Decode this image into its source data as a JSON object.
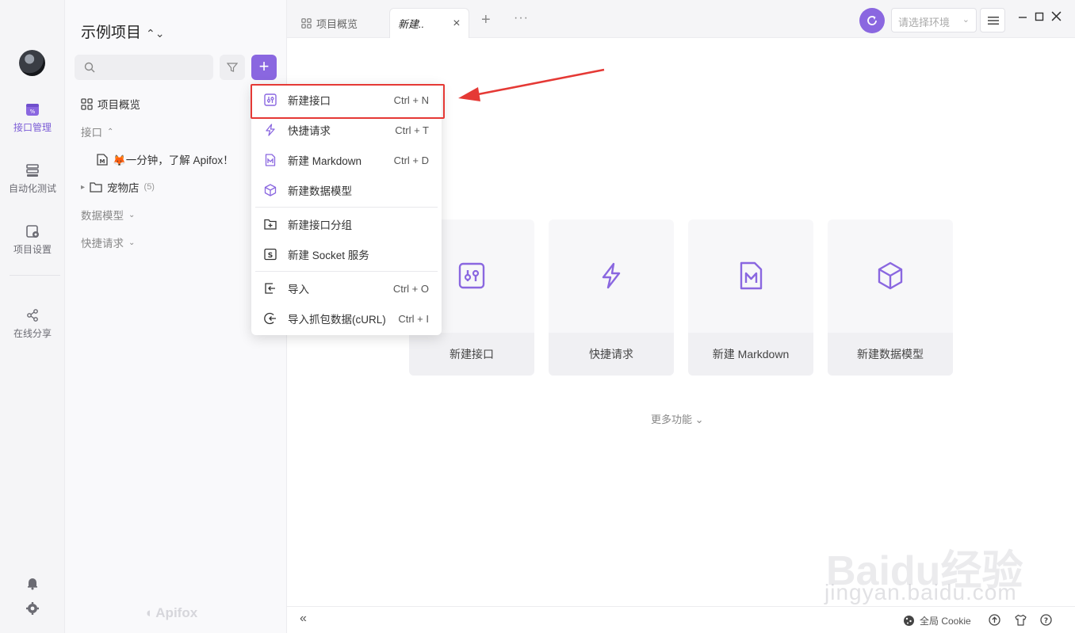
{
  "rail": {
    "items": [
      {
        "label": "接口管理"
      },
      {
        "label": "自动化测试"
      },
      {
        "label": "项目设置"
      },
      {
        "label": "在线分享"
      }
    ]
  },
  "sidebar": {
    "project_title": "示例项目",
    "overview": "项目概览",
    "section_api": "接口",
    "doc_item": "🦊一分钟，了解 Apifox！",
    "folder": "宠物店",
    "folder_count": "(5)",
    "section_models": "数据模型",
    "section_quick": "快捷请求",
    "brand": "Apifox"
  },
  "tabs": {
    "overview": "项目概览",
    "new": "新建..",
    "close": "×",
    "plus": "+",
    "more": "···"
  },
  "header": {
    "env_placeholder": "请选择环境"
  },
  "dropdown": {
    "items": [
      {
        "label": "新建接口",
        "shortcut": "Ctrl + N"
      },
      {
        "label": "快捷请求",
        "shortcut": "Ctrl + T"
      },
      {
        "label": "新建 Markdown",
        "shortcut": "Ctrl + D"
      },
      {
        "label": "新建数据模型",
        "shortcut": ""
      },
      {
        "label": "新建接口分组",
        "shortcut": ""
      },
      {
        "label": "新建 Socket 服务",
        "shortcut": ""
      },
      {
        "label": "导入",
        "shortcut": "Ctrl + O"
      },
      {
        "label": "导入抓包数据(cURL)",
        "shortcut": "Ctrl + I"
      }
    ]
  },
  "cards": [
    {
      "label": "新建接口"
    },
    {
      "label": "快捷请求"
    },
    {
      "label": "新建 Markdown"
    },
    {
      "label": "新建数据模型"
    }
  ],
  "main": {
    "more": "更多功能"
  },
  "statusbar": {
    "collapse": "«",
    "cookie": "全局 Cookie"
  },
  "watermark": {
    "logo": "Baidu经验",
    "url": "jingyan.baidu.com"
  },
  "colors": {
    "accent": "#8a67e0",
    "highlight": "#e53935"
  }
}
